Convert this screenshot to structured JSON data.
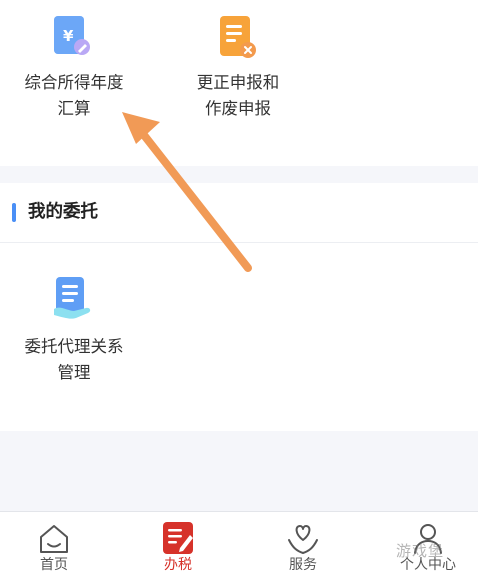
{
  "services": {
    "items": [
      {
        "label_line1": "综合所得年度",
        "label_line2": "汇算",
        "icon": "tax-document-yen-icon"
      },
      {
        "label_line1": "更正申报和",
        "label_line2": "作废申报",
        "icon": "document-cancel-icon"
      }
    ]
  },
  "delegation": {
    "title": "我的委托",
    "items": [
      {
        "label_line1": "委托代理关系",
        "label_line2": "管理",
        "icon": "delegation-document-hand-icon"
      }
    ]
  },
  "tabbar": {
    "tabs": [
      {
        "label": "首页",
        "icon": "home-icon",
        "active": false
      },
      {
        "label": "办税",
        "icon": "tax-handling-icon",
        "active": true
      },
      {
        "label": "服务",
        "icon": "service-heart-hands-icon",
        "active": false
      },
      {
        "label": "个人中心",
        "icon": "person-icon",
        "active": false
      }
    ]
  },
  "watermark": "游戏堡",
  "colors": {
    "accent_red": "#d6322a",
    "accent_blue": "#4a8ff6",
    "arrow_orange": "#f19a56",
    "icon_orange": "#f7a33a"
  }
}
